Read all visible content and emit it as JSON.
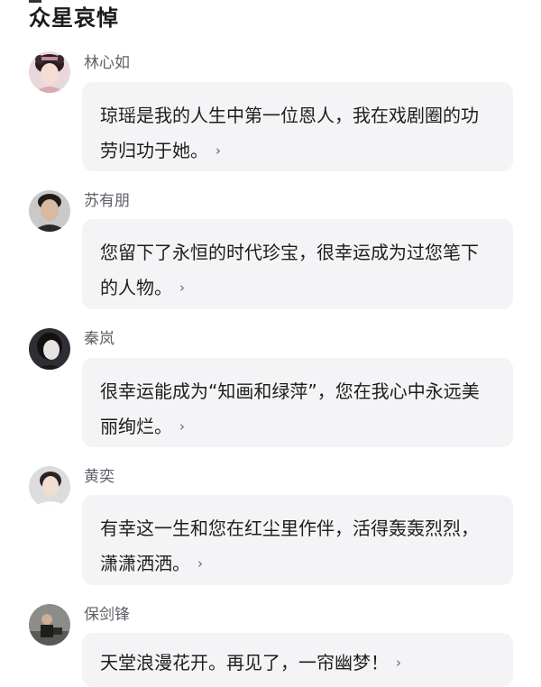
{
  "page": {
    "title": "众星哀悼"
  },
  "comments": [
    {
      "author": "林心如",
      "text": "琼瑶是我的人生中第一位恩人，我在戏剧圈的功劳归功于她。",
      "icon": "chevron-right-icon"
    },
    {
      "author": "苏有朋",
      "text": "您留下了永恒的时代珍宝，很幸运成为过您笔下的人物。",
      "icon": "chevron-right-icon"
    },
    {
      "author": "秦岚",
      "text": "很幸运能成为“知画和绿萍”，您在我心中永远美丽绚烂。",
      "icon": "chevron-right-icon"
    },
    {
      "author": "黄奕",
      "text": "有幸这一生和您在红尘里作伴，活得轰轰烈烈，潇潇洒洒。",
      "icon": "chevron-right-icon"
    },
    {
      "author": "保剑锋",
      "text": "天堂浪漫花开。再见了，一帘幽梦！",
      "icon": "chevron-right-icon"
    }
  ],
  "chevron_glyph": "›",
  "colors": {
    "bubble_bg": "#f4f4f6",
    "author_text": "#5f6068",
    "body_text": "#1e1e1e"
  }
}
